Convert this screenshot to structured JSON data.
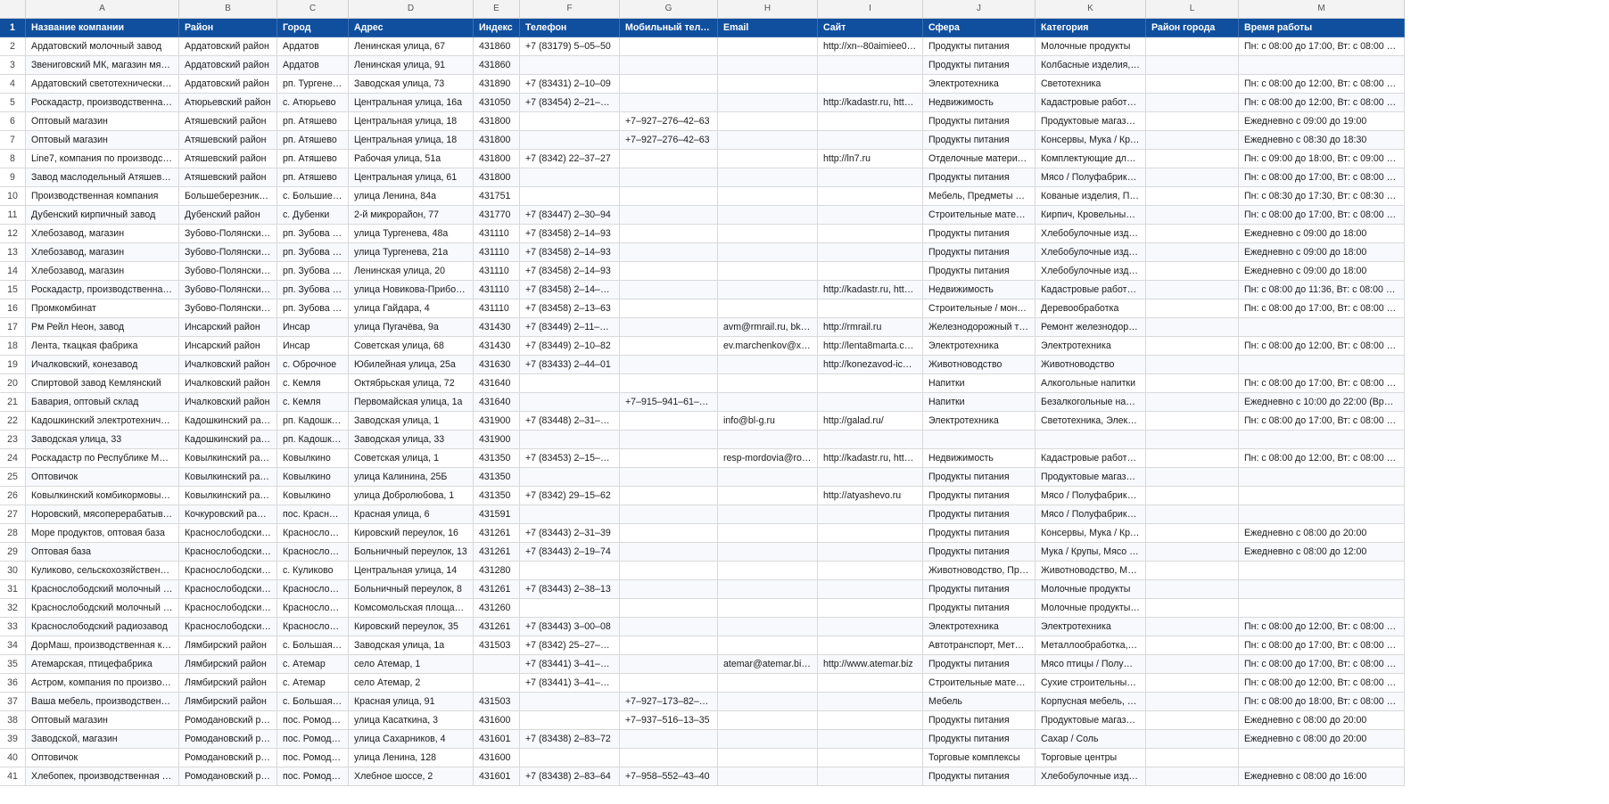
{
  "columns": [
    "A",
    "B",
    "C",
    "D",
    "E",
    "F",
    "G",
    "H",
    "I",
    "J",
    "K",
    "L",
    "M"
  ],
  "headers": {
    "row": "1",
    "cells": [
      "Название компании",
      "Район",
      "Город",
      "Адрес",
      "Индекс",
      "Телефон",
      "Мобильный телефон",
      "Email",
      "Сайт",
      "Сфера",
      "Категория",
      "Район города",
      "Время работы"
    ]
  },
  "rows": [
    {
      "n": "2",
      "cells": [
        "Ардатовский молочный завод",
        "Ардатовский район",
        "Ардатов",
        "Ленинская улица, 67",
        "431860",
        "+7 (83179) 5–05–50",
        "",
        "",
        "http://xn--80aimiee0a.xn--...",
        "Продукты питания",
        "Молочные продукты",
        "",
        "Пн: с 08:00 до 17:00, Вт: с 08:00 до 17:00, С..."
      ]
    },
    {
      "n": "3",
      "cells": [
        "Звениговский МК, магазин мяса и по...",
        "Ардатовский район",
        "Ардатов",
        "Ленинская улица, 91",
        "431860",
        "",
        "",
        "",
        "",
        "Продукты питания",
        "Колбасные изделия, Конд...",
        "",
        ""
      ]
    },
    {
      "n": "4",
      "cells": [
        "Ардатовский светотехнический завод",
        "Ардатовский район",
        "рп. Тургенево",
        "Заводская улица, 73",
        "431890",
        "+7 (83431) 2–10–09",
        "",
        "",
        "",
        "Электротехника",
        "Светотехника",
        "",
        "Пн: с 08:00 до 12:00, Вт: с 08:00 до 12:00, С..."
      ]
    },
    {
      "n": "5",
      "cells": [
        "Роскадастр, производственная групп...",
        "Атюрьевский район",
        "с. Атюрьево",
        "Центральная улица, 16а",
        "431050",
        "+7 (83454) 2–21–07, 8–...",
        "",
        "",
        "http://kadastr.ru, http://lk...",
        "Недвижимость",
        "Кадастровые работы / Тех...",
        "",
        "Пн: с 08:00 до 12:00, Вт: с 08:00 до 12:00, С..."
      ]
    },
    {
      "n": "6",
      "cells": [
        "Оптовый магазин",
        "Атяшевский район",
        "рп. Атяшево",
        "Центральная улица, 18",
        "431800",
        "",
        "+7–927–276–42–63",
        "",
        "",
        "Продукты питания",
        "Продуктовые магазины",
        "",
        "Ежедневно с 09:00 до 19:00"
      ]
    },
    {
      "n": "7",
      "cells": [
        "Оптовый магазин",
        "Атяшевский район",
        "рп. Атяшево",
        "Центральная улица, 18",
        "431800",
        "",
        "+7–927–276–42–63",
        "",
        "",
        "Продукты питания",
        "Консервы, Мука / Крупы, ...",
        "",
        "Ежедневно с 08:30 до 18:30"
      ]
    },
    {
      "n": "8",
      "cells": [
        "Line7, компания по производству око...",
        "Атяшевский район",
        "рп. Атяшево",
        "Рабочая улица, 51а",
        "431800",
        "+7 (8342) 22–37–27",
        "",
        "",
        "http://ln7.ru",
        "Отделочные материалы",
        "Комплектующие для окон,...",
        "",
        "Пн: с 09:00 до 18:00, Вт: с 09:00 до 18:00, С..."
      ]
    },
    {
      "n": "9",
      "cells": [
        "Завод маслодельный Атяшевский",
        "Атяшевский район",
        "рп. Атяшево",
        "Центральная улица, 61",
        "431800",
        "",
        "",
        "",
        "",
        "Продукты питания",
        "Мясо / Полуфабрикаты",
        "",
        "Пн: с 08:00 до 17:00, Вт: с 08:00 до 17:00, С..."
      ]
    },
    {
      "n": "10",
      "cells": [
        "Производственная компания",
        "Большеберезниковски...",
        "с. Большие Бер...",
        "улица Ленина, 84а",
        "431751",
        "",
        "",
        "",
        "",
        "Мебель, Предметы интерь...",
        "Кованые изделия, Памятн...",
        "",
        "Пн: с 08:30 до 17:30, Вт: с 08:30 до 17:30, С..."
      ]
    },
    {
      "n": "11",
      "cells": [
        "Дубенский кирпичный завод",
        "Дубенский район",
        "с. Дубенки",
        "2-й микрорайон, 77",
        "431770",
        "+7 (83447) 2–30–94",
        "",
        "",
        "",
        "Строительные материалы ...",
        "Кирпич, Кровельные мате...",
        "",
        "Пн: с 08:00 до 17:00, Вт: с 08:00 до 17:00, С..."
      ]
    },
    {
      "n": "12",
      "cells": [
        "Хлебозавод, магазин",
        "Зубово-Полянский ра...",
        "рп. Зубова Пол...",
        "улица Тургенева, 48а",
        "431110",
        "+7 (83458) 2–14–93",
        "",
        "",
        "",
        "Продукты питания",
        "Хлебобулочные изделия",
        "",
        "Ежедневно с 09:00 до 18:00"
      ]
    },
    {
      "n": "13",
      "cells": [
        "Хлебозавод, магазин",
        "Зубово-Полянский ра...",
        "рп. Зубова Пол...",
        "улица Тургенева, 21а",
        "431110",
        "+7 (83458) 2–14–93",
        "",
        "",
        "",
        "Продукты питания",
        "Хлебобулочные изделия",
        "",
        "Ежедневно с 09:00 до 18:00"
      ]
    },
    {
      "n": "14",
      "cells": [
        "Хлебозавод, магазин",
        "Зубово-Полянский ра...",
        "рп. Зубова Пол...",
        "Ленинская улица, 20",
        "431110",
        "+7 (83458) 2–14–93",
        "",
        "",
        "",
        "Продукты питания",
        "Хлебобулочные изделия",
        "",
        "Ежедневно с 09:00 до 18:00"
      ]
    },
    {
      "n": "15",
      "cells": [
        "Роскадастр, производственная групп...",
        "Зубово-Полянский ра...",
        "рп. Зубова Пол...",
        "улица Новикова-Прибоя, 67",
        "431110",
        "+7 (83458) 2–14–68, 8–...",
        "",
        "",
        "http://kadastr.ru, http://lk...",
        "Недвижимость",
        "Кадастровые работы / Тех...",
        "",
        "Пн: с 08:00 до 11:36, Вт: с 08:00 до 11:36, С..."
      ]
    },
    {
      "n": "16",
      "cells": [
        "Промкомбинат",
        "Зубово-Полянский ра...",
        "рп. Зубова Пол...",
        "улица Гайдара, 4",
        "431110",
        "+7 (83458) 2–13–63",
        "",
        "",
        "",
        "Строительные / монтажны...",
        "Деревообработка",
        "",
        "Пн: с 08:00 до 17:00, Вт: с 08:00 до 17:00, С..."
      ]
    },
    {
      "n": "17",
      "cells": [
        "Рм Рейл Неон, завод",
        "Инсарский район",
        "Инсар",
        "улица Пугачёва, 9а",
        "431430",
        "+7 (83449) 2–11–41, +7...",
        "",
        "avm@rmrail.ru, bkm@r...",
        "http://rmrail.ru",
        "Железнодорожный трансп...",
        "Ремонт железнодорожной...",
        "",
        ""
      ]
    },
    {
      "n": "18",
      "cells": [
        "Лента, ткацкая фабрика",
        "Инсарский район",
        "Инсар",
        "Советская улица, 68",
        "431430",
        "+7 (83449) 2–10–82",
        "",
        "ev.marchenkov@xnn.ru,...",
        "http://lenta8marta.com",
        "Электротехника",
        "Электротехника",
        "",
        "Пн: с 08:00 до 12:00, Вт: с 08:00 до 12:00, С..."
      ]
    },
    {
      "n": "19",
      "cells": [
        "Ичалковский, конезавод",
        "Ичалковский район",
        "с. Оброчное",
        "Юбилейная улица, 25а",
        "431630",
        "+7 (83433) 2–44–01",
        "",
        "",
        "http://konezavod-ichalki.n...",
        "Животноводство",
        "Животноводство",
        "",
        ""
      ]
    },
    {
      "n": "20",
      "cells": [
        "Спиртовой завод Кемлянский",
        "Ичалковский район",
        "с. Кемля",
        "Октябрьская улица, 72",
        "431640",
        "",
        "",
        "",
        "",
        "Напитки",
        "Алкогольные напитки",
        "",
        "Пн: с 08:00 до 17:00, Вт: с 08:00 до 17:00, С..."
      ]
    },
    {
      "n": "21",
      "cells": [
        "Бавария, оптовый склад",
        "Ичалковский район",
        "с. Кемля",
        "Первомайская улица, 1а",
        "431640",
        "",
        "+7–915–941–61–74, +7...",
        "",
        "",
        "Напитки",
        "Безалкогольные напитки, ...",
        "",
        "Ежедневно с 10:00 до 22:00 (Время прода..."
      ]
    },
    {
      "n": "22",
      "cells": [
        "Кадошкинский электротехнический з...",
        "Кадошкинский район",
        "рп. Кадошкино",
        "Заводская улица, 1",
        "431900",
        "+7 (83448) 2–31–21, +7...",
        "",
        "info@bl-g.ru",
        "http://galad.ru/",
        "Электротехника",
        "Светотехника, Электротех...",
        "",
        "Пн: с 08:00 до 17:00, Вт: с 08:00 до 17:00, С..."
      ]
    },
    {
      "n": "23",
      "cells": [
        "Заводская улица, 33",
        "Кадошкинский район",
        "рп. Кадошкино",
        "Заводская улица, 33",
        "431900",
        "",
        "",
        "",
        "",
        "",
        "",
        "",
        ""
      ]
    },
    {
      "n": "24",
      "cells": [
        "Роскадастр по Республике Мордовия,...",
        "Ковылкинский район",
        "Ковылкино",
        "Советская улица, 1",
        "431350",
        "+7 (83453) 2–15–04, 8–...",
        "",
        "resp-mordovia@rosinv.ru",
        "http://kadastr.ru, http://lk...",
        "Недвижимость",
        "Кадастровые работы / Тех...",
        "",
        "Пн: с 08:00 до 12:00, Вт: с 08:00 до 12:00, С..."
      ]
    },
    {
      "n": "25",
      "cells": [
        "Оптовичок",
        "Ковылкинский район",
        "Ковылкино",
        "улица Калинина, 25Б",
        "431350",
        "",
        "",
        "",
        "",
        "Продукты питания",
        "Продуктовые магазины",
        "",
        ""
      ]
    },
    {
      "n": "26",
      "cells": [
        "Ковылкинский комбикормовый завод",
        "Ковылкинский район",
        "Ковылкино",
        "улица Добролюбова, 1",
        "431350",
        "+7 (8342) 29–15–62",
        "",
        "",
        "http://atyashevo.ru",
        "Продукты питания",
        "Мясо / Полуфабрикаты",
        "",
        ""
      ]
    },
    {
      "n": "27",
      "cells": [
        "Норовский, мясоперерабатывающий...",
        "Кочкуровский район",
        "пос. Красномай...",
        "Красная улица, 6",
        "431591",
        "",
        "",
        "",
        "",
        "Продукты питания",
        "Мясо / Полуфабрикаты",
        "",
        ""
      ]
    },
    {
      "n": "28",
      "cells": [
        "Море продуктов, оптовая база",
        "Краснослободский рай...",
        "Краснослободск",
        "Кировский переулок, 16",
        "431261",
        "+7 (83443) 2–31–39",
        "",
        "",
        "",
        "Продукты питания",
        "Консервы, Мука / Крупы, ...",
        "",
        "Ежедневно с 08:00 до 20:00"
      ]
    },
    {
      "n": "29",
      "cells": [
        "Оптовая база",
        "Краснослободский рай...",
        "Краснослободск",
        "Больничный переулок, 13",
        "431261",
        "+7 (83443) 2–19–74",
        "",
        "",
        "",
        "Продукты питания",
        "Мука / Крупы, Мясо / Пол...",
        "",
        "Ежедневно с 08:00 до 12:00"
      ]
    },
    {
      "n": "30",
      "cells": [
        "Куликово, сельскохозяйственный про...",
        "Краснослободский рай...",
        "с. Куликово",
        "Центральная улица, 14",
        "431280",
        "",
        "",
        "",
        "",
        "Животноводство, Продукт...",
        "Животноводство, Молочн...",
        "",
        ""
      ]
    },
    {
      "n": "31",
      "cells": [
        "Краснослободский молочный завод",
        "Краснослободский рай...",
        "Краснослободск",
        "Больничный переулок, 8",
        "431261",
        "+7 (83443) 2–38–13",
        "",
        "",
        "",
        "Продукты питания",
        "Молочные продукты",
        "",
        ""
      ]
    },
    {
      "n": "32",
      "cells": [
        "Краснослободский молочный завод",
        "Краснослободский рай...",
        "Краснослободск",
        "Комсомольская площадь, 20",
        "431260",
        "",
        "",
        "",
        "",
        "Продукты питания",
        "Молочные продукты, Мор...",
        "",
        ""
      ]
    },
    {
      "n": "33",
      "cells": [
        "Краснослободский радиозавод",
        "Краснослободский рай...",
        "Краснослободск",
        "Кировский переулок, 35",
        "431261",
        "+7 (83443) 3–00–08",
        "",
        "",
        "",
        "Электротехника",
        "Электротехника",
        "",
        "Пн: с 08:00 до 12:00, Вт: с 08:00 до 12:00, С..."
      ]
    },
    {
      "n": "34",
      "cells": [
        "ДорМаш, производственная компания",
        "Лямбирский район",
        "с. Большая Елх...",
        "Заводская улица, 1а",
        "431503",
        "+7 (8342) 25–27–27, +7...",
        "",
        "",
        "",
        "Автотранспорт, Металлы",
        "Металлообработка, Сельх...",
        "",
        "Пн: с 08:00 до 17:00, Вт: с 08:00 до 17:00, С..."
      ]
    },
    {
      "n": "35",
      "cells": [
        "Атемарская, птицефабрика",
        "Лямбирский район",
        "с. Атемар",
        "село Атемар, 1",
        "",
        "+7 (83441) 3–41–00, +7...",
        "",
        "atemar@atemar.biz, ate...",
        "http://www.atemar.biz",
        "Продукты питания",
        "Мясо птицы / Полуфабрик...",
        "",
        "Пн: с 08:00 до 17:00, Вт: с 08:00 до 17:00, С..."
      ]
    },
    {
      "n": "36",
      "cells": [
        "Астром, компания по производству и...",
        "Лямбирский район",
        "с. Атемар",
        "село Атемар, 2",
        "",
        "+7 (83441) 3–41–10, +7...",
        "",
        "",
        "",
        "Строительные материалы ...",
        "Сухие строительные смеси",
        "",
        "Пн: с 08:00 до 12:00, Вт: с 08:00 до 12:00, С..."
      ]
    },
    {
      "n": "37",
      "cells": [
        "Ваша мебель, производственная ком...",
        "Лямбирский район",
        "с. Большая Елх...",
        "Красная улица, 91",
        "431503",
        "",
        "+7–927–173–82–70, +7...",
        "",
        "",
        "Мебель",
        "Корпусная мебель, Мебел...",
        "",
        "Пн: с 08:00 до 18:00, Вт: с 08:00 до 18:00, С..."
      ]
    },
    {
      "n": "38",
      "cells": [
        "Оптовый магазин",
        "Ромодановский район",
        "пос. Ромоданово",
        "улица Касаткина, 3",
        "431600",
        "",
        "+7–937–516–13–35",
        "",
        "",
        "Продукты питания",
        "Продуктовые магазины",
        "",
        "Ежедневно с 08:00 до 20:00"
      ]
    },
    {
      "n": "39",
      "cells": [
        "Заводской, магазин",
        "Ромодановский район",
        "пос. Ромоданово",
        "улица Сахарников, 4",
        "431601",
        "+7 (83438) 2–83–72",
        "",
        "",
        "",
        "Продукты питания",
        "Сахар / Соль",
        "",
        "Ежедневно с 08:00 до 20:00"
      ]
    },
    {
      "n": "40",
      "cells": [
        "Оптовичок",
        "Ромодановский район",
        "пос. Ромоданово",
        "улица Ленина, 128",
        "431600",
        "",
        "",
        "",
        "",
        "Торговые комплексы",
        "Торговые центры",
        "",
        ""
      ]
    },
    {
      "n": "41",
      "cells": [
        "Хлебопек, производственная компан...",
        "Ромодановский район",
        "пос. Ромоданово",
        "Хлебное шоссе, 2",
        "431601",
        "+7 (83438) 2–83–64",
        "+7–958–552–43–40",
        "",
        "",
        "Продукты питания",
        "Хлебобулочные изделия",
        "",
        "Ежедневно с 08:00 до 16:00"
      ]
    }
  ]
}
